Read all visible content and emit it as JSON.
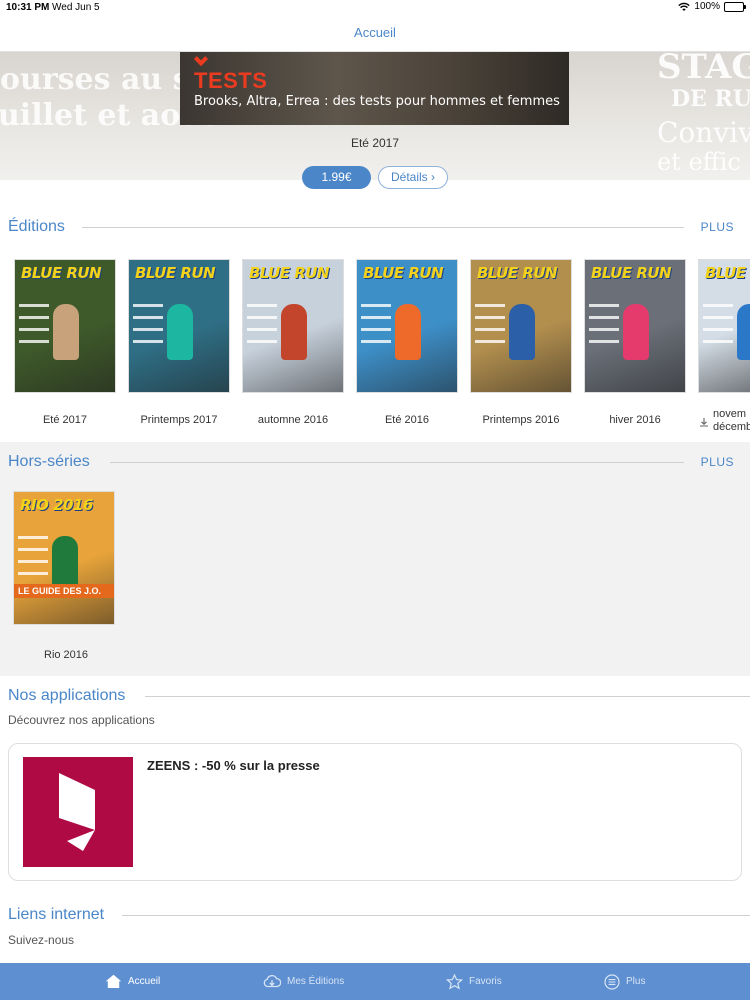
{
  "status_bar": {
    "time": "10:31 PM",
    "date": "Wed Jun 5",
    "battery": "100%"
  },
  "nav": {
    "title": "Accueil"
  },
  "hero": {
    "bg_left_lines": [
      "ourses au somm",
      "uillet et août"
    ],
    "bg_right_lines": [
      "STAGE",
      "DE RUN",
      "Convivi",
      "et effic"
    ],
    "cover_headline": "TESTS",
    "cover_subline": "Brooks, Altra, Errea : des tests pour hommes et femmes",
    "issue_title": "Eté 2017",
    "price": "1.99€",
    "details": "Détails ›"
  },
  "editions": {
    "title": "Éditions",
    "more": "PLUS",
    "items": [
      {
        "label": "Eté 2017",
        "masthead": "BLUE RUN",
        "bg": "#3f5a2a",
        "fig": "#c7a27a"
      },
      {
        "label": "Printemps 2017",
        "masthead": "BLUE RUN",
        "bg": "#2f6f86",
        "fig": "#1db6a0"
      },
      {
        "label": "automne 2016",
        "masthead": "BLUE RUN",
        "bg": "#c7d1dc",
        "fig": "#c3452b"
      },
      {
        "label": "Eté 2016",
        "masthead": "BLUE RUN",
        "bg": "#3d8fc8",
        "fig": "#ee6a2a"
      },
      {
        "label": "Printemps 2016",
        "masthead": "BLUE RUN",
        "bg": "#b38f4e",
        "fig": "#2b5fa8"
      },
      {
        "label": "hiver 2016",
        "masthead": "BLUE RUN",
        "bg": "#6a6f78",
        "fig": "#e43b6c"
      },
      {
        "label": "novem décemb",
        "masthead": "BLUE",
        "bg": "#d4dde6",
        "fig": "#2b77c8"
      }
    ]
  },
  "hors_series": {
    "title": "Hors-séries",
    "more": "PLUS",
    "items": [
      {
        "label": "Rio 2016",
        "masthead": "RIO 2016",
        "bg": "#e8a43a",
        "fig": "#1f7a3c",
        "guide": "LE GUIDE DES J.O."
      }
    ]
  },
  "apps": {
    "title": "Nos applications",
    "subtitle": "Découvrez nos applications",
    "card_title": "ZEENS : -50 % sur la presse"
  },
  "links": {
    "title": "Liens internet",
    "subtitle": "Suivez-nous"
  },
  "tabs": [
    {
      "label": "Accueil",
      "icon": "home-icon"
    },
    {
      "label": "Mes Éditions",
      "icon": "cloud-download-icon"
    },
    {
      "label": "Favoris",
      "icon": "star-icon"
    },
    {
      "label": "Plus",
      "icon": "menu-circle-icon"
    }
  ],
  "colors": {
    "accent": "#4a86c8",
    "tab_bar": "#5e8fd1",
    "zeens_brand": "#b00a45"
  }
}
